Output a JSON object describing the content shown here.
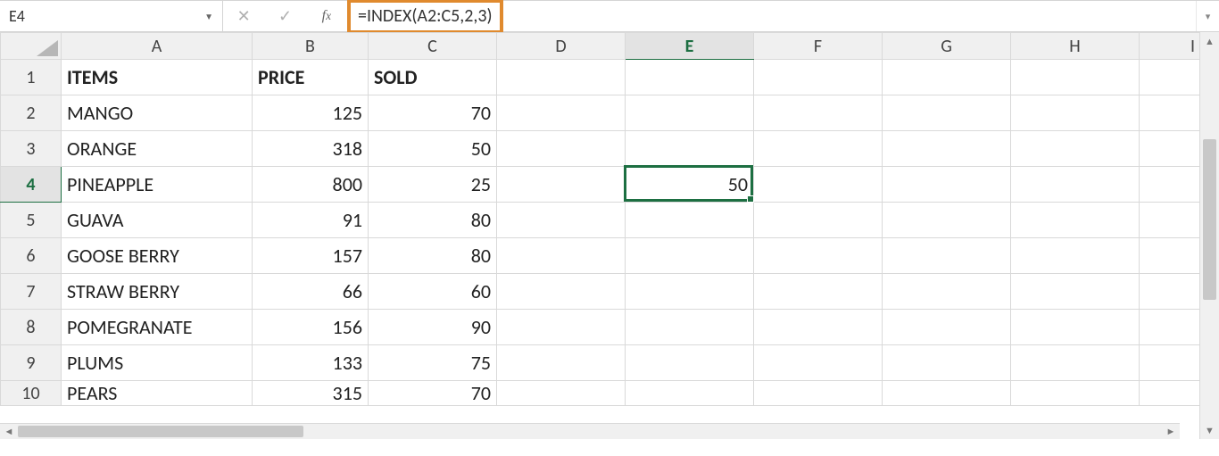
{
  "name_box": "E4",
  "formula": "=INDEX(A2:C5,2,3)",
  "highlight_color": "#e08a2e",
  "columns": [
    "A",
    "B",
    "C",
    "D",
    "E",
    "F",
    "G",
    "H",
    "I"
  ],
  "active_cell": {
    "col": "E",
    "row": 4,
    "value": "50"
  },
  "rows": [
    {
      "n": 1,
      "A": "ITEMS",
      "B": "PRICE",
      "C": "SOLD",
      "bold": true,
      "numericB": false,
      "numericC": false
    },
    {
      "n": 2,
      "A": "MANGO",
      "B": "125",
      "C": "70"
    },
    {
      "n": 3,
      "A": "ORANGE",
      "B": "318",
      "C": "50"
    },
    {
      "n": 4,
      "A": "PINEAPPLE",
      "B": "800",
      "C": "25",
      "E": "50"
    },
    {
      "n": 5,
      "A": "GUAVA",
      "B": "91",
      "C": "80"
    },
    {
      "n": 6,
      "A": "GOOSE BERRY",
      "B": "157",
      "C": "80"
    },
    {
      "n": 7,
      "A": "STRAW BERRY",
      "B": "66",
      "C": "60"
    },
    {
      "n": 8,
      "A": "POMEGRANATE",
      "B": "156",
      "C": "90"
    },
    {
      "n": 9,
      "A": "PLUMS",
      "B": "133",
      "C": "75"
    },
    {
      "n": 10,
      "A": "PEARS",
      "B": "315",
      "C": "70"
    }
  ]
}
